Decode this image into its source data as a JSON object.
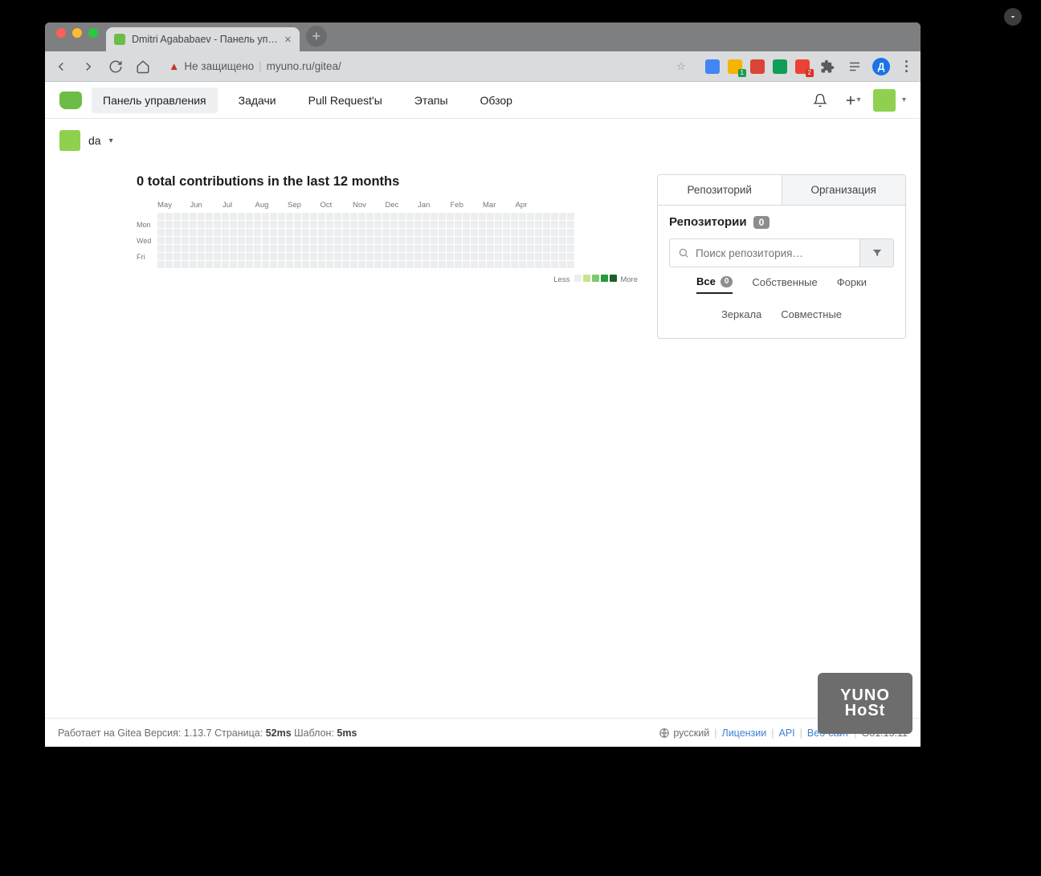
{
  "browser": {
    "tab_title": "Dmitri Agababaev - Панель уп…",
    "security_label": "Не защищено",
    "url": "myuno.ru/gitea/",
    "profile_initial": "Д",
    "ext_badge_green": "1",
    "ext_badge_red": "2"
  },
  "nav": {
    "items": [
      "Панель управления",
      "Задачи",
      "Pull Request'ы",
      "Этапы",
      "Обзор"
    ]
  },
  "context": {
    "username": "da"
  },
  "contrib": {
    "title": "0 total contributions in the last 12 months",
    "months": [
      "May",
      "Jun",
      "Jul",
      "Aug",
      "Sep",
      "Oct",
      "Nov",
      "Dec",
      "Jan",
      "Feb",
      "Mar",
      "Apr"
    ],
    "days": [
      "Mon",
      "Wed",
      "Fri"
    ],
    "legend_less": "Less",
    "legend_more": "More",
    "legend_colors": [
      "#eceef0",
      "#c6e48b",
      "#7bc96f",
      "#239a3b",
      "#196127"
    ]
  },
  "right": {
    "tabs": [
      "Репозиторий",
      "Организация"
    ],
    "panel_title": "Репозитории",
    "repo_count": "0",
    "search_placeholder": "Поиск репозитория…",
    "filter_tabs": {
      "all": "Все",
      "all_count": "0",
      "own": "Собственные",
      "forks": "Форки",
      "mirrors": "Зеркала",
      "collab": "Совместные"
    }
  },
  "footer": {
    "powered_pre": "Работает на Gitea Версия: 1.13.7 Страница: ",
    "page_time": "52ms",
    "template_label": " Шаблон: ",
    "template_time": "5ms",
    "lang": "русский",
    "licenses": "Лицензии",
    "api": "API",
    "website": "Веб-сайт",
    "go": "Go1.15.11"
  },
  "yuno": "YUNO HoSt"
}
